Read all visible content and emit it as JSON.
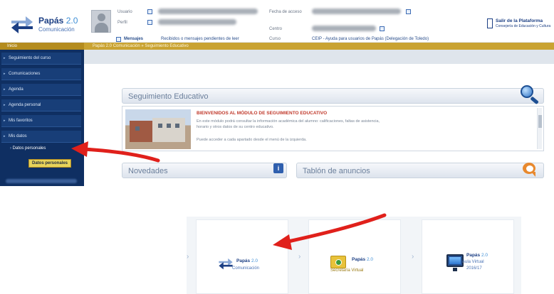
{
  "header": {
    "logo": {
      "brand": "Papás",
      "version": "2.0",
      "subtitle": "Comunicación"
    },
    "fields": {
      "row1_label1": "Usuario",
      "row2_label1": "Perfil",
      "row1_label2": "Fecha de acceso",
      "row2_label2": "Centro",
      "row3_label2": "Curso"
    },
    "messages_label": "Mensajes",
    "messages_link": "Recibidos o mensajes pendientes de leer",
    "centro_text": "CEIP - Ayuda para usuarios de Papás (Delegación de Toledo)",
    "exit": {
      "title": "Salir de la Plataforma",
      "subtitle": "Consejería de Educación y Cultura"
    }
  },
  "goldbar": {
    "home": "Inicio",
    "crumb": "Papás 2.0 Comunicación » Seguimiento Educativo"
  },
  "sidebar": {
    "items": [
      {
        "label": "Seguimiento del curso"
      },
      {
        "label": "Comunicaciones"
      },
      {
        "label": "Agenda"
      },
      {
        "label": "Agenda personal"
      },
      {
        "label": "Mis favoritos"
      },
      {
        "label": "Mis datos"
      }
    ],
    "sub_item": "Datos personales",
    "button": "Datos personales"
  },
  "panels": {
    "seguimiento": {
      "title": "Seguimiento Educativo",
      "heading": "BIENVENIDOS AL MÓDULO DE SEGUIMIENTO EDUCATIVO",
      "line1": "En este módulo podrá consultar la información académica del alumno: calificaciones, faltas de asistencia,",
      "line2": "horario y otros datos de su centro educativo.",
      "line3": "Puede acceder a cada apartado desde el menú de la izquierda."
    },
    "novedades": {
      "title": "Novedades",
      "icon": "info-icon"
    },
    "tablon": {
      "title": "Tablón de anuncios",
      "icon": "speech-bubble-icon"
    }
  },
  "tiles": [
    {
      "brand": "Papás",
      "version": "2.0",
      "subtitle": "Comunicación",
      "icon": "papas-arrows-icon"
    },
    {
      "brand": "Papás",
      "version": "2.0",
      "subtitle": "Secretaría Virtual",
      "icon": "folder-icon"
    },
    {
      "brand": "Papás",
      "version": "2.0",
      "subtitle": "Aula Virtual",
      "extra": "2016/17",
      "icon": "monitor-icon"
    }
  ],
  "colors": {
    "navy": "#0f2f62",
    "gold": "#c9a332",
    "annotation_red": "#e0201b",
    "brand_blue": "#1c3f84"
  }
}
